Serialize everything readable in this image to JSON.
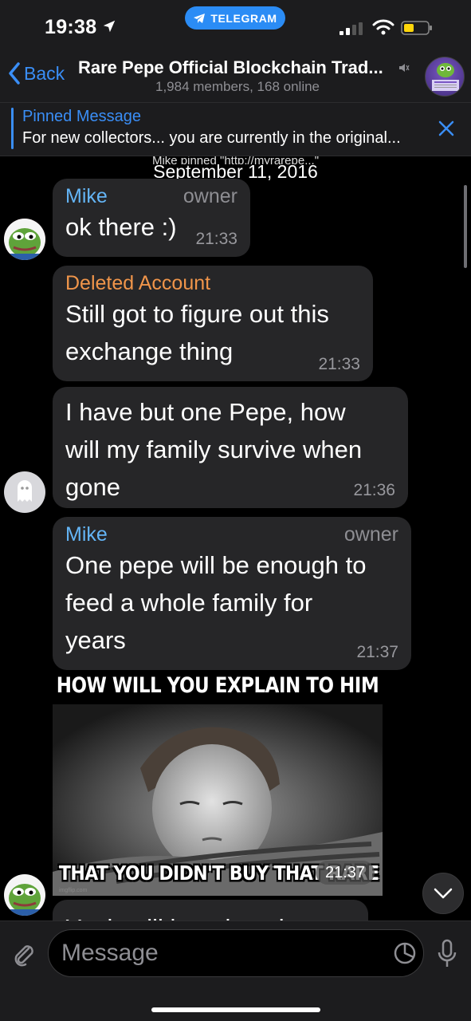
{
  "status_bar": {
    "time": "19:38",
    "banner": "TELEGRAM",
    "accent": "#2b8cf5",
    "battery_color": "#ffd60a"
  },
  "header": {
    "back_label": "Back",
    "title": "Rare Pepe Official Blockchain Trad...",
    "subtitle": "1,984 members, 168 online",
    "accent": "#3a8ef6"
  },
  "pinned": {
    "title": "Pinned Message",
    "text": "For new collectors... you are currently in the original..."
  },
  "chat": {
    "service_message": "Mike pinned \"http://myrarepe...\"",
    "date": "September 11, 2016",
    "messages": [
      {
        "sender": "Mike",
        "sender_color": "#64b5f6",
        "role": "owner",
        "text_lines": [
          "ok there :)"
        ],
        "time": "21:33"
      },
      {
        "sender": "Deleted Account",
        "sender_color": "#f0954a",
        "text_lines": [
          "Still got to figure out this",
          "exchange thing"
        ],
        "time": "21:33"
      },
      {
        "text_lines": [
          "I have but one Pepe, how",
          "will my family survive when",
          "gone"
        ],
        "time": "21:36"
      },
      {
        "sender": "Mike",
        "sender_color": "#64b5f6",
        "role": "owner",
        "text_lines": [
          "One pepe will be enough to",
          "feed a whole family for",
          "years"
        ],
        "time": "21:37"
      }
    ],
    "meme": {
      "top_text": "HOW WILL YOU EXPLAIN TO HIM",
      "bottom_text": "THAT YOU DIDN'T BUY THAT RARE PEPE",
      "watermark": "imgflip.com",
      "time": "21:37"
    },
    "partial_message": "Yeah still learning about"
  },
  "input": {
    "placeholder": "Message"
  },
  "icons": {
    "back": "chevron-left-icon",
    "close": "close-icon",
    "attach": "paperclip-icon",
    "sticker": "sticker-icon",
    "mic": "microphone-icon",
    "jump": "chevron-down-icon"
  }
}
